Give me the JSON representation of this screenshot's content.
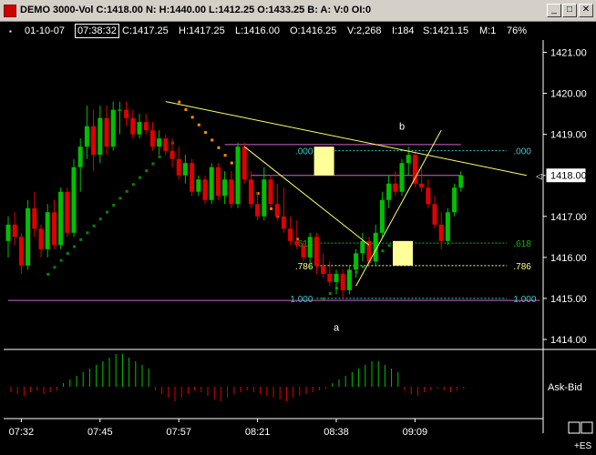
{
  "window": {
    "title": "DEMO 3000-Vol C:1418.00 N: H:1440.00 L:1412.25 O:1433.25 B: A: V:0 OI:0",
    "minimize": "_",
    "maximize": "□",
    "close": "✕"
  },
  "infobar": {
    "marker": "▪",
    "date": "01-10-07",
    "time": "07:38:32",
    "close": "C:1417.25",
    "high": "H:1417.25",
    "low": "L:1416.00",
    "open": "O:1416.25",
    "volume": "V:2,268",
    "index": "I:184",
    "s": "S:1421.15",
    "interval": "M:1",
    "zoom": "76%"
  },
  "colors": {
    "up": "#00c000",
    "down": "#e00000",
    "upper_dots": "#ff8c00",
    "lower_dots": "#008800",
    "trendline": "#ffff66",
    "level_line": "#cc66cc",
    "fib_line": "#33cccc",
    "fib_yellow": "#ffff88",
    "highlight": "#ffff99",
    "axis": "#ffffff"
  },
  "chart_data": {
    "type": "candlestick",
    "instrument": "+ES",
    "y_axis": {
      "ticks": [
        "1421.00",
        "1420.00",
        "1419.00",
        "1418.00",
        "1417.00",
        "1416.00",
        "1415.00",
        "1414.00"
      ],
      "tick_values": [
        1421,
        1420,
        1419,
        1418,
        1417,
        1416,
        1415,
        1414
      ],
      "range": [
        1413.8,
        1421.3
      ],
      "current_price": "1418.00"
    },
    "x_axis": {
      "labels": [
        "07:32",
        "07:45",
        "07:57",
        "08:21",
        "08:38",
        "09:09"
      ],
      "label_bars": [
        2,
        14,
        26,
        38,
        50,
        62
      ]
    },
    "candles": [
      {
        "o": 1416.4,
        "h": 1417.0,
        "l": 1416.0,
        "c": 1416.8
      },
      {
        "o": 1416.8,
        "h": 1417.1,
        "l": 1416.3,
        "c": 1416.5
      },
      {
        "o": 1416.5,
        "h": 1416.6,
        "l": 1415.6,
        "c": 1415.8
      },
      {
        "o": 1415.8,
        "h": 1417.4,
        "l": 1415.7,
        "c": 1417.2
      },
      {
        "o": 1417.2,
        "h": 1417.6,
        "l": 1416.5,
        "c": 1416.7
      },
      {
        "o": 1416.7,
        "h": 1416.8,
        "l": 1416.0,
        "c": 1416.2
      },
      {
        "o": 1416.2,
        "h": 1417.3,
        "l": 1416.0,
        "c": 1417.1
      },
      {
        "o": 1417.1,
        "h": 1417.4,
        "l": 1416.2,
        "c": 1416.3
      },
      {
        "o": 1416.3,
        "h": 1417.7,
        "l": 1416.2,
        "c": 1417.6
      },
      {
        "o": 1417.6,
        "h": 1417.7,
        "l": 1416.5,
        "c": 1416.6
      },
      {
        "o": 1416.6,
        "h": 1418.4,
        "l": 1416.5,
        "c": 1418.2
      },
      {
        "o": 1418.2,
        "h": 1418.9,
        "l": 1417.6,
        "c": 1418.7
      },
      {
        "o": 1418.7,
        "h": 1419.7,
        "l": 1418.4,
        "c": 1419.2
      },
      {
        "o": 1419.2,
        "h": 1419.6,
        "l": 1418.1,
        "c": 1418.5
      },
      {
        "o": 1418.5,
        "h": 1419.7,
        "l": 1418.3,
        "c": 1419.4
      },
      {
        "o": 1419.4,
        "h": 1419.7,
        "l": 1418.5,
        "c": 1418.7
      },
      {
        "o": 1418.7,
        "h": 1419.8,
        "l": 1418.6,
        "c": 1419.6
      },
      {
        "o": 1419.6,
        "h": 1419.8,
        "l": 1419.0,
        "c": 1419.6
      },
      {
        "o": 1419.6,
        "h": 1419.8,
        "l": 1419.2,
        "c": 1419.4
      },
      {
        "o": 1419.4,
        "h": 1419.6,
        "l": 1418.9,
        "c": 1419.0
      },
      {
        "o": 1419.0,
        "h": 1419.5,
        "l": 1418.9,
        "c": 1419.3
      },
      {
        "o": 1419.3,
        "h": 1419.5,
        "l": 1419.0,
        "c": 1419.1
      },
      {
        "o": 1419.1,
        "h": 1419.3,
        "l": 1418.6,
        "c": 1418.7
      },
      {
        "o": 1418.7,
        "h": 1419.1,
        "l": 1418.5,
        "c": 1418.9
      },
      {
        "o": 1418.9,
        "h": 1419.0,
        "l": 1418.5,
        "c": 1418.6
      },
      {
        "o": 1418.6,
        "h": 1418.9,
        "l": 1418.2,
        "c": 1418.4
      },
      {
        "o": 1418.4,
        "h": 1418.7,
        "l": 1417.9,
        "c": 1418.0
      },
      {
        "o": 1418.0,
        "h": 1418.5,
        "l": 1417.8,
        "c": 1418.3
      },
      {
        "o": 1418.3,
        "h": 1418.4,
        "l": 1417.5,
        "c": 1417.6
      },
      {
        "o": 1417.6,
        "h": 1418.0,
        "l": 1417.5,
        "c": 1417.9
      },
      {
        "o": 1417.9,
        "h": 1418.0,
        "l": 1417.3,
        "c": 1417.4
      },
      {
        "o": 1417.4,
        "h": 1418.3,
        "l": 1417.3,
        "c": 1418.2
      },
      {
        "o": 1418.2,
        "h": 1418.3,
        "l": 1417.4,
        "c": 1417.5
      },
      {
        "o": 1417.5,
        "h": 1418.1,
        "l": 1417.3,
        "c": 1417.9
      },
      {
        "o": 1417.9,
        "h": 1418.1,
        "l": 1417.2,
        "c": 1417.3
      },
      {
        "o": 1417.3,
        "h": 1418.8,
        "l": 1417.2,
        "c": 1418.7
      },
      {
        "o": 1418.7,
        "h": 1418.8,
        "l": 1417.8,
        "c": 1417.9
      },
      {
        "o": 1417.9,
        "h": 1418.1,
        "l": 1417.2,
        "c": 1417.3
      },
      {
        "o": 1417.3,
        "h": 1417.6,
        "l": 1416.9,
        "c": 1417.0
      },
      {
        "o": 1417.0,
        "h": 1418.2,
        "l": 1416.9,
        "c": 1417.9
      },
      {
        "o": 1417.9,
        "h": 1418.0,
        "l": 1417.2,
        "c": 1417.3
      },
      {
        "o": 1417.3,
        "h": 1417.8,
        "l": 1416.9,
        "c": 1417.0
      },
      {
        "o": 1417.0,
        "h": 1417.7,
        "l": 1416.6,
        "c": 1416.7
      },
      {
        "o": 1416.7,
        "h": 1417.0,
        "l": 1416.3,
        "c": 1416.4
      },
      {
        "o": 1416.4,
        "h": 1416.9,
        "l": 1416.2,
        "c": 1416.3
      },
      {
        "o": 1416.3,
        "h": 1416.4,
        "l": 1415.9,
        "c": 1416.0
      },
      {
        "o": 1416.0,
        "h": 1416.6,
        "l": 1415.7,
        "c": 1416.5
      },
      {
        "o": 1416.5,
        "h": 1416.6,
        "l": 1415.6,
        "c": 1415.8
      },
      {
        "o": 1415.8,
        "h": 1416.1,
        "l": 1415.5,
        "c": 1415.6
      },
      {
        "o": 1415.6,
        "h": 1415.9,
        "l": 1415.3,
        "c": 1415.4
      },
      {
        "o": 1415.4,
        "h": 1415.7,
        "l": 1415.1,
        "c": 1415.6
      },
      {
        "o": 1415.6,
        "h": 1415.7,
        "l": 1415.0,
        "c": 1415.2
      },
      {
        "o": 1415.2,
        "h": 1415.8,
        "l": 1415.1,
        "c": 1415.7
      },
      {
        "o": 1415.7,
        "h": 1416.2,
        "l": 1415.5,
        "c": 1416.1
      },
      {
        "o": 1416.1,
        "h": 1416.6,
        "l": 1415.9,
        "c": 1416.4
      },
      {
        "o": 1416.4,
        "h": 1416.5,
        "l": 1415.8,
        "c": 1415.9
      },
      {
        "o": 1415.9,
        "h": 1416.8,
        "l": 1415.8,
        "c": 1416.6
      },
      {
        "o": 1416.6,
        "h": 1417.6,
        "l": 1416.5,
        "c": 1417.4
      },
      {
        "o": 1417.4,
        "h": 1418.0,
        "l": 1417.2,
        "c": 1417.8
      },
      {
        "o": 1417.8,
        "h": 1418.1,
        "l": 1417.5,
        "c": 1417.6
      },
      {
        "o": 1417.6,
        "h": 1418.4,
        "l": 1417.5,
        "c": 1418.3
      },
      {
        "o": 1418.3,
        "h": 1418.7,
        "l": 1418.0,
        "c": 1418.5
      },
      {
        "o": 1418.5,
        "h": 1418.6,
        "l": 1417.7,
        "c": 1417.8
      },
      {
        "o": 1417.8,
        "h": 1418.2,
        "l": 1417.6,
        "c": 1417.7
      },
      {
        "o": 1417.7,
        "h": 1417.9,
        "l": 1417.2,
        "c": 1417.3
      },
      {
        "o": 1417.3,
        "h": 1417.5,
        "l": 1416.7,
        "c": 1416.8
      },
      {
        "o": 1416.8,
        "h": 1417.1,
        "l": 1416.2,
        "c": 1416.4
      },
      {
        "o": 1416.4,
        "h": 1417.2,
        "l": 1416.3,
        "c": 1417.1
      },
      {
        "o": 1417.1,
        "h": 1417.8,
        "l": 1417.0,
        "c": 1417.7
      },
      {
        "o": 1417.7,
        "h": 1418.1,
        "l": 1417.6,
        "c": 1418.0
      }
    ],
    "upper_dots": [
      {
        "start": 26,
        "end": 47,
        "from": 1419.8,
        "to": 1415.9
      }
    ],
    "lower_dots": [
      {
        "start": 6,
        "end": 25,
        "from": 1415.6,
        "to": 1418.8
      },
      {
        "start": 48,
        "end": 58,
        "from": 1415.0,
        "to": 1416.3
      }
    ],
    "trendlines": [
      {
        "from": [
          24,
          1419.8
        ],
        "to": [
          79,
          1418.0
        ],
        "color": "trendline"
      },
      {
        "from": [
          36,
          1418.7
        ],
        "to": [
          55,
          1416.3
        ],
        "color": "trendline"
      },
      {
        "from": [
          53,
          1415.3
        ],
        "to": [
          66,
          1419.1
        ],
        "color": "trendline"
      }
    ],
    "horizontal_levels": [
      {
        "price": 1418.75,
        "from": 33,
        "to": 69,
        "color": "level_line"
      },
      {
        "price": 1418.0,
        "from": 37,
        "to": 69,
        "color": "level_line"
      },
      {
        "price": 1414.95,
        "from": 0,
        "to": 81,
        "color": "level_line"
      }
    ],
    "fib_levels": [
      {
        "label_left": ".000",
        "label_right": ".000",
        "price": 1418.6
      },
      {
        "label_left": ".618",
        "label_right": ".618",
        "price": 1416.35
      },
      {
        "label_left": ".786",
        "label_right": ".786",
        "price": 1415.8
      },
      {
        "label_left": "1.000",
        "label_right": "1.000",
        "price": 1415.0
      }
    ],
    "highlight_boxes": [
      {
        "bar": 48,
        "top": 1418.7,
        "bottom": 1418.0
      },
      {
        "bar": 60,
        "top": 1416.4,
        "bottom": 1415.8
      }
    ],
    "annotations": [
      {
        "text": "b",
        "bar": 60,
        "price": 1419.2
      },
      {
        "text": "a",
        "bar": 50,
        "price": 1414.3
      }
    ],
    "indicator": {
      "name": "Ask-Bid",
      "values": [
        -3,
        -4,
        -5,
        -3,
        -2,
        -4,
        -3,
        -2,
        2,
        4,
        6,
        8,
        10,
        12,
        14,
        16,
        18,
        18,
        16,
        14,
        12,
        10,
        -2,
        -4,
        -6,
        -8,
        -6,
        -4,
        -2,
        -3,
        -5,
        -7,
        -8,
        -6,
        -4,
        -3,
        -2,
        -3,
        -4,
        -5,
        -6,
        -7,
        -8,
        -6,
        -5,
        -4,
        -3,
        -2,
        -1,
        2,
        4,
        6,
        8,
        10,
        12,
        14,
        14,
        12,
        10,
        8,
        -2,
        -4,
        -5,
        -3,
        -2,
        -1,
        -2,
        -3,
        -2,
        -1
      ]
    }
  }
}
